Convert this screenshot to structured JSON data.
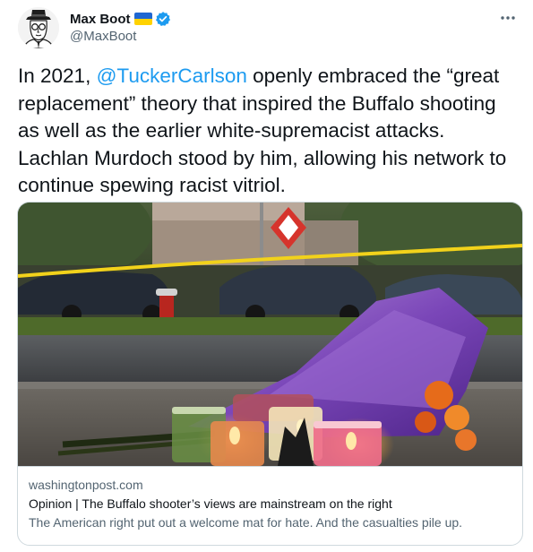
{
  "author": {
    "display_name": "Max Boot",
    "handle": "@MaxBoot",
    "flag_icon": "ukraine-flag-icon",
    "verified_icon": "verified-badge-icon",
    "avatar_icon": "caricature-avatar"
  },
  "menu": {
    "more_icon": "more-horizontal-icon"
  },
  "tweet": {
    "text_before": "In 2021, ",
    "mention": "@TuckerCarlson",
    "text_after": " openly embraced the “great replacement” theory that inspired the Buffalo shooting as well as the earlier white-supremacist attacks. Lachlan Murdoch stood by him, allowing his network to continue spewing racist vitriol."
  },
  "card": {
    "domain": "washingtonpost.com",
    "title": "Opinion | The Buffalo shooter’s views are mainstream on the right",
    "description": "The American right put out a welcome mat for hate. And the casualties pile up.",
    "image": "memorial-flowers-candles-photo"
  },
  "colors": {
    "accent": "#1d9bf0",
    "text": "#0f1419",
    "secondary_text": "#536471",
    "border": "#cfd9de"
  }
}
